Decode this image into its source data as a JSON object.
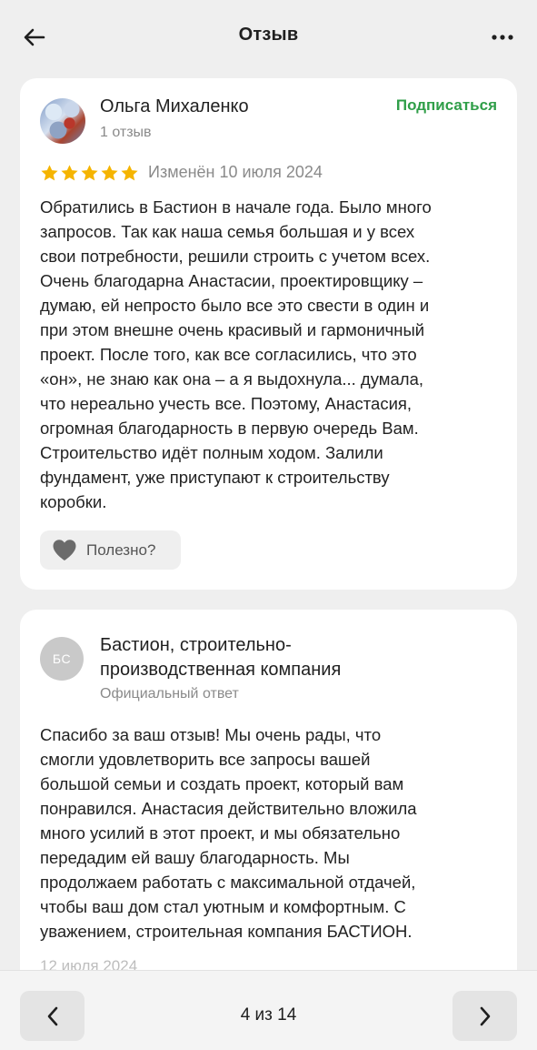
{
  "header": {
    "title": "Отзыв",
    "back_icon": "arrow-left-icon",
    "more_icon": "more-dots-icon"
  },
  "review": {
    "author_name": "Ольга Михаленко",
    "author_reviews": "1 отзыв",
    "subscribe_label": "Подписаться",
    "rating": 5,
    "rating_max": 5,
    "edited": "Изменён 10 июля 2024",
    "text": "Обратились в Бастион в начале года. Было много\nзапросов. Так как наша семья большая и у всех\nсвои потребности, решили строить с учетом всех.\nОчень благодарна Анастасии, проектировщику –\nдумаю, ей непросто было все это свести в один и\nпри этом внешне очень красивый и гармоничный\nпроект. После того, как все согласились, что это\n«он», не знаю как она – а я выдохнула... думала,\nчто нереально учесть все. Поэтому, Анастасия,\nогромная благодарность в первую очередь Вам.\nСтроительство идёт полным ходом. Залили\nфундамент, уже приступают к строительству\nкоробки.",
    "useful_label": "Полезно?"
  },
  "reply": {
    "avatar_initials": "БС",
    "company_name": "Бастион, строительно-\nпроизводственная компания",
    "official_label": "Официальный ответ",
    "text": "Спасибо за ваш отзыв! Мы очень рады, что\nсмогли удовлетворить все запросы вашей\nбольшой семьи и создать проект, который вам\nпонравился. Анастасия действительно вложила\nмного усилий в этот проект, и мы обязательно\nпередадим ей вашу благодарность. Мы\nпродолжаем работать с максимальной отдачей,\nчтобы ваш дом стал уютным и комфортным. С\nуважением, строительная компания БАСТИОН.",
    "date": "12 июля 2024"
  },
  "pagination": {
    "label": "4 из 14",
    "prev_icon": "chevron-left-icon",
    "next_icon": "chevron-right-icon"
  },
  "colors": {
    "accent_green": "#2f9e48",
    "star_gold": "#f5b400",
    "background": "#efefef"
  }
}
